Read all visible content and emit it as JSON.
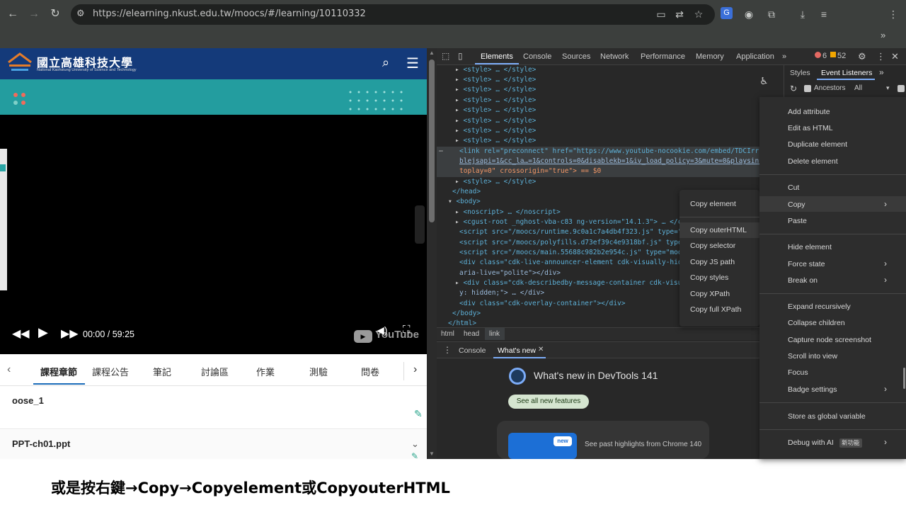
{
  "browser": {
    "url": "https://elearning.nkust.edu.tw/moocs/#/learning/10110332"
  },
  "site": {
    "name": "國立高雄科技大學",
    "subtitle": "National Kaohsiung University of Science and Technology"
  },
  "video": {
    "time": "00:00 / 59:25",
    "brand": "YouTube"
  },
  "course_tabs": [
    "課程章節",
    "課程公告",
    "筆記",
    "討論區",
    "作業",
    "測驗",
    "問卷"
  ],
  "active_tab": "課程章節",
  "list_items": [
    {
      "title": "oose_1"
    },
    {
      "title": "PPT-ch01.ppt"
    }
  ],
  "devtools": {
    "tabs": [
      "Elements",
      "Console",
      "Sources",
      "Network",
      "Performance",
      "Memory",
      "Application"
    ],
    "active_tab": "Elements",
    "error_count": "6",
    "warning_count": "52",
    "side_tabs": [
      "Styles",
      "Event Listeners"
    ],
    "ancestors_label": "Ancestors",
    "ancestors_value": "All",
    "breadcrumb": [
      "html",
      "head",
      "link"
    ],
    "drawer_tabs": [
      "Console",
      "What's new"
    ],
    "whats_new_title": "What's new in DevTools 141",
    "see_all_button": "See all new features",
    "highlights_badge": "new",
    "highlights_text": "See past highlights from Chrome 140",
    "code_lines": [
      "<style> … </style>",
      "<link rel=\"preconnect\" href=\"https://www.youtube-nocookie.com/embed/TDCIrrnXFtk?",
      "blejsapi=1&cc_la…=1&controls=0&disablekb=1&iv_load_policy=3&mute=0&playsinline=1",
      "toplay=0\" crossorigin=\"true\"> == $0",
      "</head>",
      "<body>",
      "<noscript> … </noscript>",
      "<cgust-root _nghost-vba-c83 ng-version=\"14.1.3\"> … </cgust",
      "<script src=\"/moocs/runtime.9c0a1c7a4db4f323.js\" type=\"mod",
      "<script src=\"/moocs/polyfills.d73ef39c4e9318bf.js\" type=\"m",
      "<script src=\"/moocs/main.55688c982b2e954c.js\" type=\"module",
      "<div class=\"cdk-live-announcer-element cdk-visually-hidden",
      "aria-live=\"polite\"></div>",
      "<div class=\"cdk-describedby-message-container cdk-visually",
      "y: hidden;\"> … </div>",
      "<div class=\"cdk-overlay-container\"></div>",
      "</body>",
      "</html>"
    ]
  },
  "copy_submenu": [
    "Copy element",
    "Copy outerHTML",
    "Copy selector",
    "Copy JS path",
    "Copy styles",
    "Copy XPath",
    "Copy full XPath"
  ],
  "context_menu": {
    "add_attribute": "Add attribute",
    "edit_html": "Edit as HTML",
    "duplicate": "Duplicate element",
    "delete": "Delete element",
    "cut": "Cut",
    "copy": "Copy",
    "paste": "Paste",
    "hide": "Hide element",
    "force_state": "Force state",
    "break_on": "Break on",
    "expand": "Expand recursively",
    "collapse": "Collapse children",
    "capture": "Capture node screenshot",
    "scroll": "Scroll into view",
    "focus": "Focus",
    "badge": "Badge settings",
    "store": "Store as global variable",
    "debug": "Debug with AI",
    "debug_badge": "新功能"
  },
  "caption": "或是按右鍵→Copy→Copyelement或CopyouterHTML"
}
